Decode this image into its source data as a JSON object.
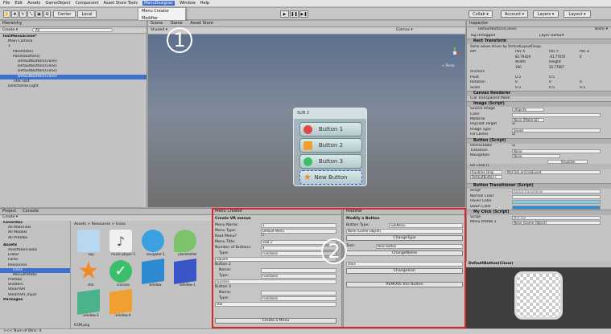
{
  "menubar": {
    "items": [
      "File",
      "Edit",
      "Assets",
      "GameObject",
      "Component",
      "Asset Store Tools",
      "MenuDesigner",
      "Window",
      "Help"
    ],
    "active_index": 6
  },
  "dropdown": {
    "items": [
      "Menu Creator",
      "Modifier"
    ]
  },
  "toolbar": {
    "center_label": "Center",
    "local_label": "Local",
    "collab": "Collab ▾",
    "account": "Account ▾",
    "layers": "Layers ▾",
    "layout": "Layout ▾"
  },
  "hierarchy": {
    "title": "Hierarchy",
    "create": "Create ▾",
    "search_placeholder": "All",
    "rows": [
      "TestMenuScene*",
      "Main Camera",
      "1",
      "Panel(title)",
      "Panel(Buttons)",
      "DefaultButton(Clone)",
      "DefaultButton(Clone)",
      "DefaultButton(Clone)",
      "DefaultButton(Clone)",
      "Title Text",
      "Directional Light"
    ],
    "selected_index": 8
  },
  "scene": {
    "tabs": [
      "Scene",
      "Game",
      "Asset Store"
    ],
    "shaded": "Shaded ▾",
    "gizmos": "Gizmos ▾",
    "persp": "< Persp",
    "panel_title": "SUB 2",
    "buttons": [
      "Button 1",
      "Button 2",
      "Button 3",
      "New Button"
    ]
  },
  "inspector": {
    "title": "Inspector",
    "name": "DefaultButton(Clone)",
    "static": "Static ▾",
    "tag_label": "Tag",
    "tag": "Untagged",
    "layer_label": "Layer",
    "layer": "Default",
    "rect_transform": "Rect Transform",
    "rect_note": "Some values driven by VerticalLayoutGroup.",
    "left_label": "left",
    "pos_x_label": "Pos X",
    "pos_y_label": "Pos Y",
    "pos_z_label": "Pos Z",
    "pos_x": "82.79429",
    "pos_y": "-61.77655",
    "pos_z": "0",
    "width_label": "Width",
    "height_label": "Height",
    "width": "160",
    "height": "30.77667",
    "anchors": "Anchors",
    "pivot": "Pivot",
    "pivot_x": "0.5",
    "pivot_y": "0.5",
    "rotation": "Rotation",
    "rot_x": "0",
    "rot_y": "0",
    "rot_z": "0",
    "scale": "Scale",
    "scale_x": "0.5",
    "scale_y": "0.5",
    "scale_z": "0.5",
    "canvas_renderer": "Canvas Renderer",
    "cull": "Cull Transparent Mesh",
    "image_script": "Image (Script)",
    "source_image": "Source Image",
    "source_val": "UISprite",
    "color": "Color",
    "material": "Material",
    "material_val": "None (Material)",
    "raycast": "Raycast Target",
    "image_type": "Image Type",
    "image_type_val": "Sliced",
    "fill_center": "Fill Center",
    "button_script": "Button (Script)",
    "interactable": "Interactable",
    "transition": "Transition",
    "transition_val": "None",
    "navigation": "Navigation",
    "navigation_val": "None",
    "visualize": "Visualize",
    "onclick": "On Click ()",
    "runtime": "Runtime Only",
    "onclick_fn": "MyClick.onClickEvent",
    "onclick_obj": "DefaultButton (",
    "transitioner": "Button Transitioner (Script)",
    "script": "Script",
    "script_val": "ButtonTransitioner",
    "normal_color": "Normal Color",
    "hover_color": "Hover Color",
    "down_color": "Down Color",
    "myclick": "My Click (Script)",
    "script2_val": "MyClick",
    "menu_prefab": "Menu Prefab 1",
    "menu_prefab_val": "None (Game Object)",
    "preview_title": "DefaultButton(Clone)"
  },
  "project": {
    "tabs": [
      "Project",
      "Console"
    ],
    "create": "Create ▾",
    "breadcrumb": "Assets > Resources > Icons",
    "favorites": "Favorites",
    "fav_items": [
      "All Materials",
      "All Models",
      "All Prefabs"
    ],
    "assets": "Assets",
    "asset_items": [
      "AssetStoreTools",
      "Editor",
      "Fonts",
      "Resources",
      "Icons",
      "MenuPrefabs",
      "Prefabs",
      "Shaders",
      "SteamVR",
      "SteamVR_Input"
    ],
    "packages": "Packages",
    "icons": [
      "exp",
      "music-player-3",
      "navigator-1",
      "placeholder",
      "star",
      "success",
      "window",
      "window-1",
      "window-3",
      "window-4"
    ],
    "footer": "ICON.png"
  },
  "menu_creator": {
    "title": "Menu Creator",
    "heading": "Create VR menus",
    "menu_name_label": "Menu Name:",
    "menu_name": "1",
    "menu_type_label": "Menu Type:",
    "menu_type": "Default Menu",
    "root_label": "Root Menu?",
    "title_label": "Menu Title:",
    "title_val": "SUB 2",
    "num_label": "Number of Buttons:",
    "num_val": "4",
    "type_label": "Type:",
    "type_val": "Functions",
    "square": "Square",
    "button2": "Button 2",
    "name_label": "Name:",
    "success": "success",
    "button3": "Button 3",
    "star": "star",
    "create_btn": "Create a Menu"
  },
  "modifier": {
    "title": "Modifier",
    "heading": "Modify a Button",
    "btype_label": "Button Type:",
    "btype_val": "SubMenu",
    "go_val": "None (Game Object)",
    "change_type": "ChangeType",
    "text_label": "Text:",
    "text_val": "New Button",
    "change_name": "ChangeName",
    "icon_label": "stars",
    "change_icon": "ChangeIcon",
    "remove": "REMOVE this Button"
  },
  "callouts": {
    "one": "1",
    "two": "2"
  },
  "status": {
    "text": "<<< Num of Btns: 4"
  },
  "colors": {
    "highlight": "#d8262c",
    "selection": "#3e6fd1"
  }
}
